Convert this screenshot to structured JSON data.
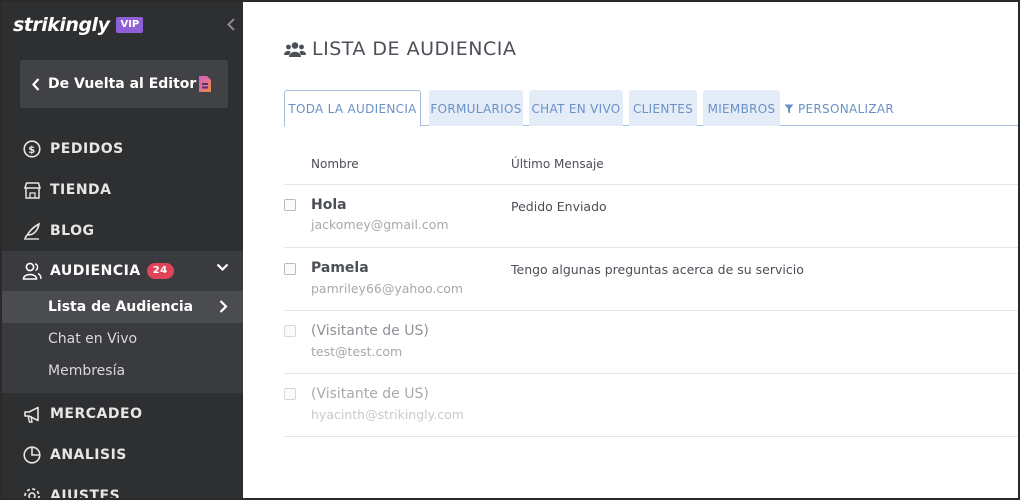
{
  "brand": {
    "logo_text": "strikingly",
    "vip": "VIP"
  },
  "sidebar": {
    "back_button": "De Vuelta al Editor",
    "items": [
      {
        "label": "PEDIDOS",
        "icon": "dollar-circle-icon"
      },
      {
        "label": "TIENDA",
        "icon": "store-icon"
      },
      {
        "label": "BLOG",
        "icon": "quill-icon"
      },
      {
        "label": "AUDIENCIA",
        "icon": "users-icon",
        "badge": "24",
        "active": true
      },
      {
        "label": "MERCADEO",
        "icon": "megaphone-icon"
      },
      {
        "label": "ANALISIS",
        "icon": "pie-chart-icon"
      },
      {
        "label": "AJUSTES",
        "icon": "gear-icon"
      }
    ],
    "subitems": [
      {
        "label": "Lista de Audiencia",
        "active": true
      },
      {
        "label": "Chat en Vivo"
      },
      {
        "label": "Membresía"
      }
    ]
  },
  "main": {
    "title": "LISTA DE AUDIENCIA",
    "tabs": [
      {
        "label": "TODA LA AUDIENCIA",
        "active": true
      },
      {
        "label": "FORMULARIOS"
      },
      {
        "label": "CHAT EN VIVO"
      },
      {
        "label": "CLIENTES"
      },
      {
        "label": "MIEMBROS"
      },
      {
        "label": "PERSONALIZAR",
        "icon": "filter-icon"
      }
    ],
    "columns": {
      "name": "Nombre",
      "last_message": "Último Mensaje"
    },
    "rows": [
      {
        "name": "Hola",
        "email": "jackomey@gmail.com",
        "message": "Pedido Enviado"
      },
      {
        "name": "Pamela",
        "email": "pamriley66@yahoo.com",
        "message": "Tengo algunas preguntas acerca de su servicio"
      },
      {
        "name": "(Visitante de US)",
        "email": "test@test.com",
        "message": ""
      },
      {
        "name": "(Visitante de US)",
        "email": "hyacinth@strikingly.com",
        "message": ""
      }
    ]
  },
  "colors": {
    "sidebar_bg": "#2e2f31",
    "vip_purple": "#8e5fd6",
    "badge_red": "#e0445a",
    "tab_blue": "#6a91c6",
    "tab_bg": "#e3ecf7"
  }
}
